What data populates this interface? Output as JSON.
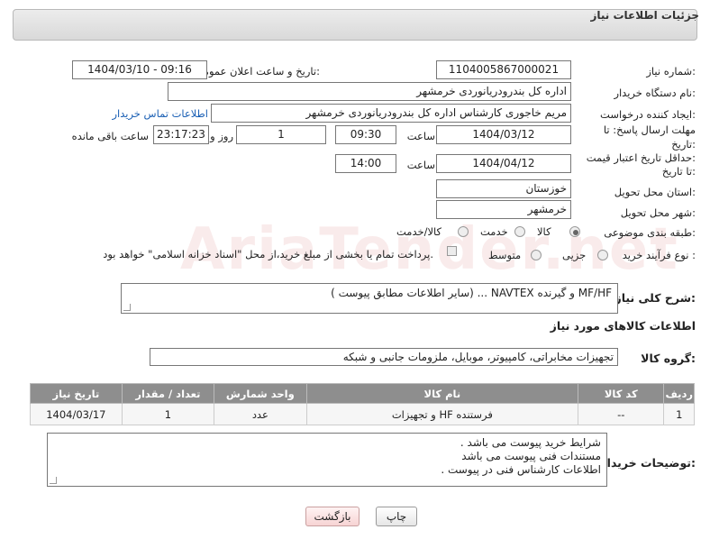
{
  "header": {
    "title": "جزئیات اطلاعات نیاز"
  },
  "watermark": "AriaTender.net",
  "fields": {
    "need_number_label": "شماره نیاز:",
    "need_number": "1104005867000021",
    "announce_label": "تاریخ و ساعت اعلان عمومی:",
    "announce_value": "1404/03/10 - 09:16",
    "buyer_org_label": "نام دستگاه خریدار:",
    "buyer_org": "اداره کل بندرودریانوردی خرمشهر",
    "creator_label": "ایجاد کننده درخواست:",
    "creator": "مریم خاجوری کارشناس اداره کل بندرودریانوردی خرمشهر",
    "contact_link": "اطلاعات تماس خریدار",
    "reply_deadline_label_1": "مهلت ارسال پاسخ: تا",
    "reply_deadline_label_2": "تاریخ:",
    "reply_date": "1404/03/12",
    "time_label": "ساعت",
    "reply_time": "09:30",
    "days_value": "1",
    "days_label": "روز و",
    "remaining_time": "23:17:23",
    "remaining_label": "ساعت باقی مانده",
    "price_validity_label_1": "حداقل تاریخ اعتبار قیمت:",
    "price_validity_label_2": "تا تاریخ:",
    "price_date": "1404/04/12",
    "price_time": "14:00",
    "province_label": "استان محل تحویل:",
    "province": "خوزستان",
    "city_label": "شهر محل تحویل:",
    "city": "خرمشهر",
    "category_label": "طبقه بندی موضوعی:",
    "category_options": [
      "کالا",
      "خدمت",
      "کالا/خدمت"
    ],
    "process_label": "نوع فرآیند خرید :",
    "process_options": [
      "جزیی",
      "متوسط"
    ],
    "payment_note": "پرداخت تمام یا بخشی از مبلغ خرید،از محل \"اسناد خزانه اسلامی\" خواهد بود."
  },
  "need_desc": {
    "label": "شرح کلی نیاز:",
    "value": "MF/HF  و گیرنده  NAVTEX  ... (سایر اطلاعات مطابق پیوست )"
  },
  "goods_section": {
    "title": "اطلاعات کالاهای مورد نیاز",
    "group_label": "گروه کالا:",
    "group_value": "تجهیزات مخابراتی، کامپیوتر، موبایل، ملزومات جانبی و شبکه"
  },
  "table": {
    "headers": [
      "ردیف",
      "کد کالا",
      "نام کالا",
      "واحد شمارش",
      "تعداد / مقدار",
      "تاریخ نیاز"
    ],
    "rows": [
      [
        "1",
        "--",
        "فرستنده HF و تجهیزات",
        "عدد",
        "1",
        "1404/03/17"
      ]
    ]
  },
  "buyer_notes": {
    "label": "توضیحات خریدار:",
    "lines": [
      "شرایط خرید پیوست می باشد .",
      "مستندات فنی پیوست می باشد",
      "اطلاعات کارشناس فنی در پیوست ."
    ]
  },
  "buttons": {
    "print": "چاپ",
    "back": "بازگشت"
  }
}
